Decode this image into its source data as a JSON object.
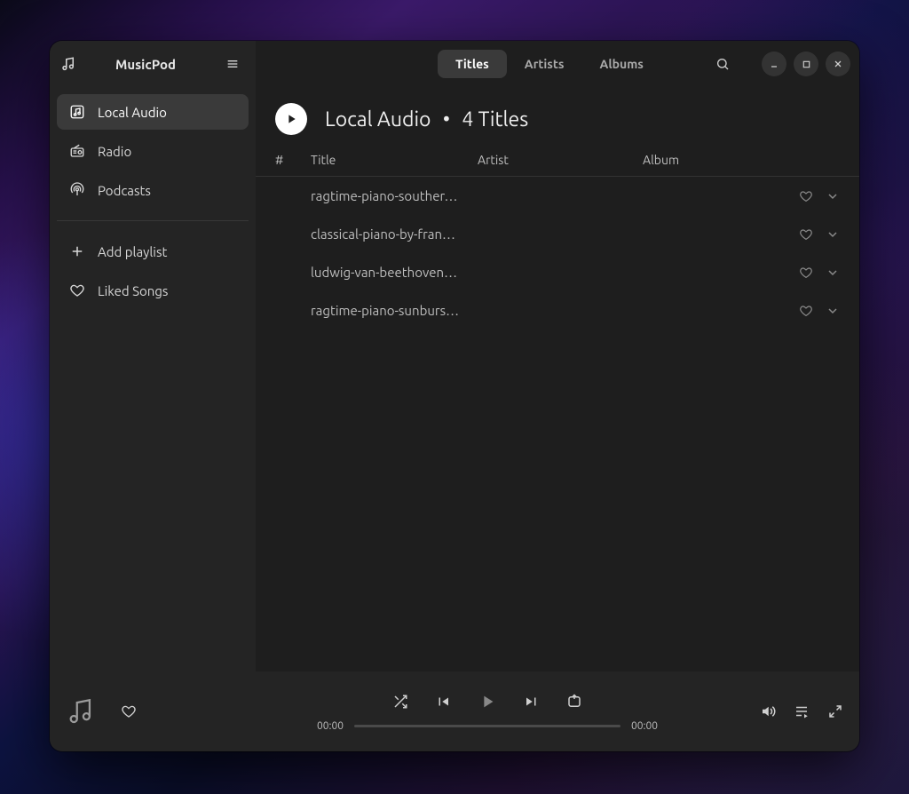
{
  "app": {
    "title": "MusicPod"
  },
  "sidebar": {
    "items": [
      {
        "label": "Local Audio",
        "icon": "square-music-icon",
        "active": true
      },
      {
        "label": "Radio",
        "icon": "radio-icon",
        "active": false
      },
      {
        "label": "Podcasts",
        "icon": "podcast-icon",
        "active": false
      }
    ],
    "extras": [
      {
        "label": "Add playlist",
        "icon": "plus-icon"
      },
      {
        "label": "Liked Songs",
        "icon": "heart-icon"
      }
    ]
  },
  "tabs": [
    {
      "label": "Titles",
      "active": true
    },
    {
      "label": "Artists",
      "active": false
    },
    {
      "label": "Albums",
      "active": false
    }
  ],
  "page": {
    "heading": "Local Audio",
    "separator": "•",
    "subheading": "4 Titles"
  },
  "columns": {
    "number": "#",
    "title": "Title",
    "artist": "Artist",
    "album": "Album"
  },
  "tracks": [
    {
      "title": "ragtime-piano-souther…"
    },
    {
      "title": "classical-piano-by-fran…"
    },
    {
      "title": "ludwig-van-beethoven…"
    },
    {
      "title": "ragtime-piano-sunburs…"
    }
  ],
  "player": {
    "elapsed": "00:00",
    "total": "00:00"
  }
}
